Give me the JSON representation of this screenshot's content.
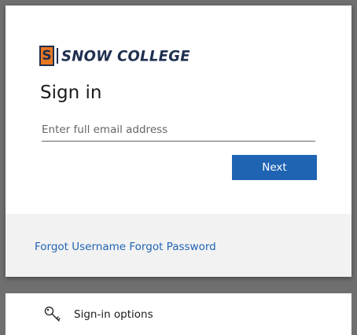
{
  "brand": {
    "logo_letter": "S",
    "logo_text": "SNOW COLLEGE",
    "colors": {
      "orange": "#e87722",
      "navy": "#1f2f4f",
      "accent": "#1f64b3"
    }
  },
  "signin": {
    "title": "Sign in",
    "email_placeholder": "Enter full email address",
    "email_value": "",
    "next_label": "Next"
  },
  "links": {
    "forgot_username": "Forgot Username",
    "forgot_password": "Forgot Password"
  },
  "options": {
    "label": "Sign-in options",
    "icon": "key-icon"
  }
}
